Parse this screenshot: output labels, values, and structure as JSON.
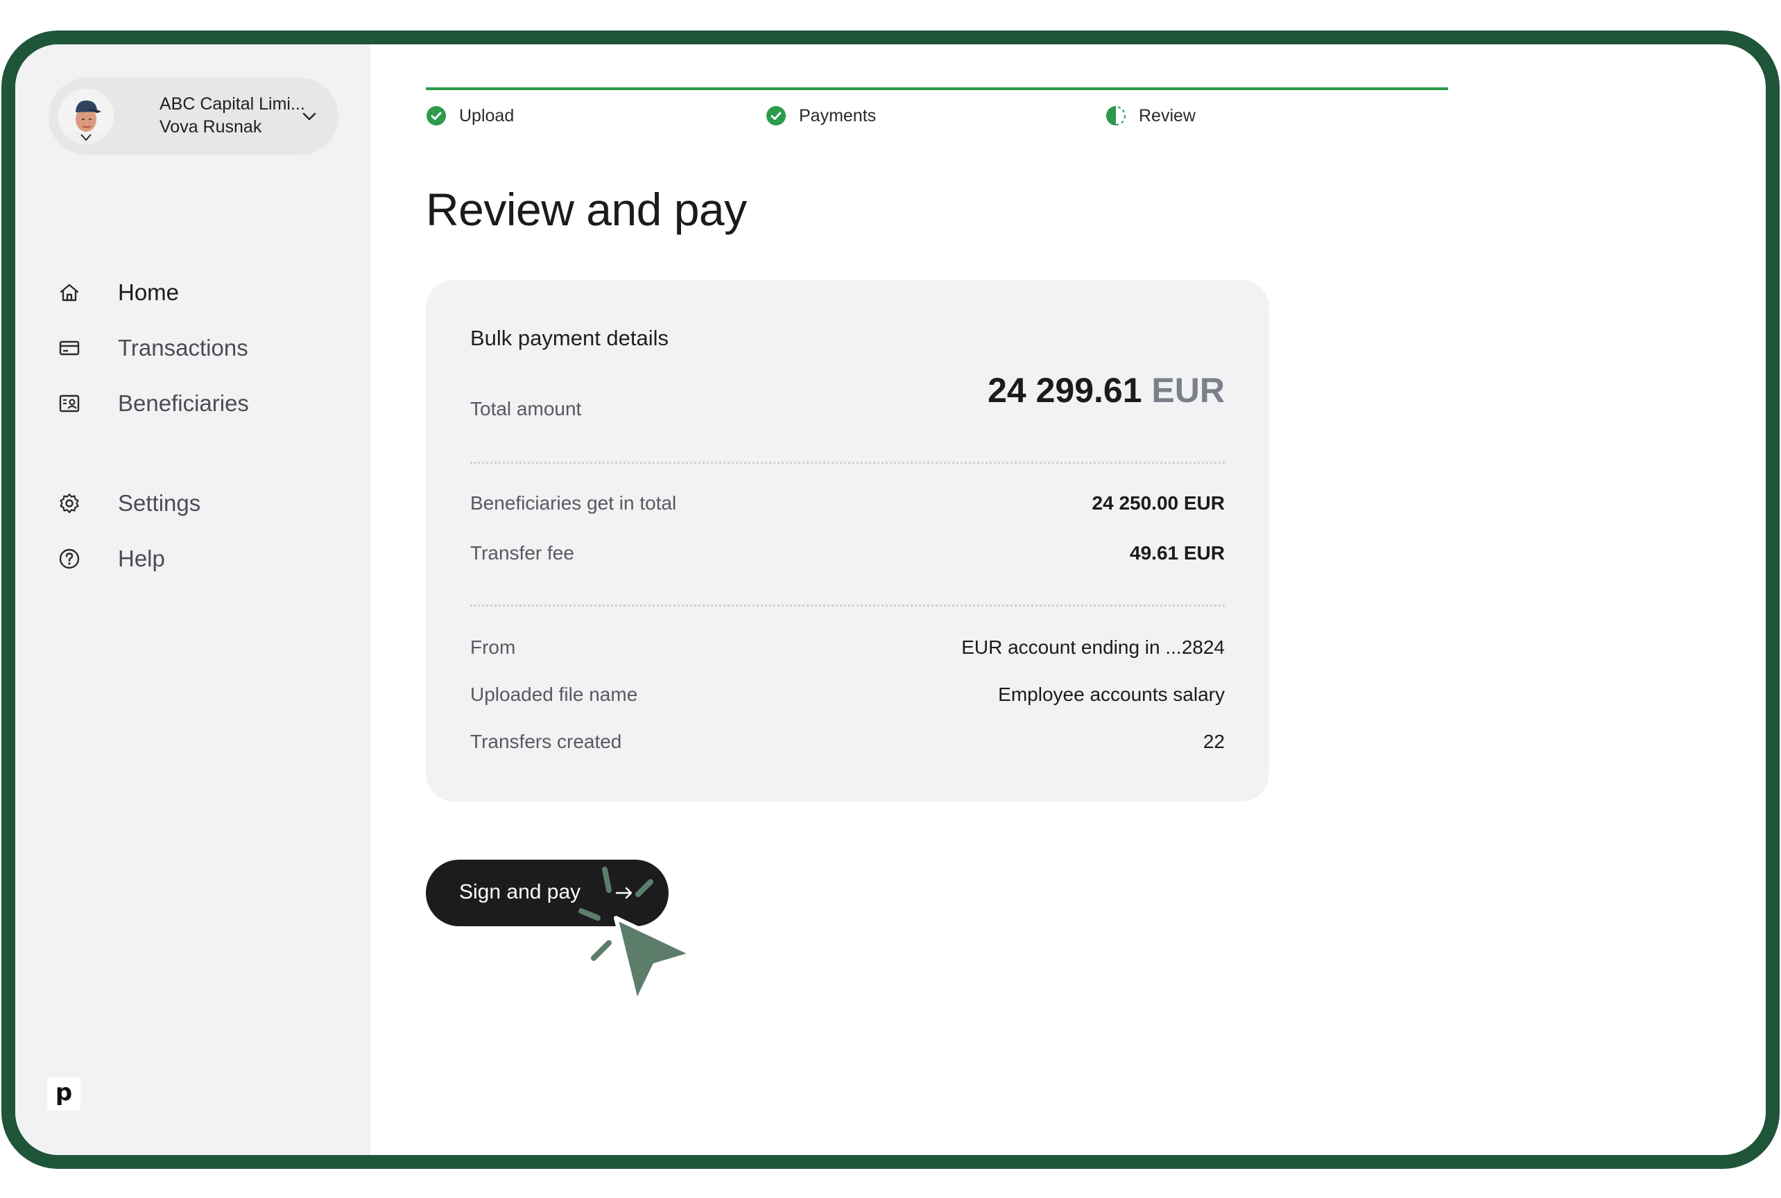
{
  "sidebar": {
    "account": {
      "company": "ABC Capital Limi...",
      "user": "Vova Rusnak",
      "avatar_icon": "user-avatar",
      "dropdown_icon": "chevron-down-icon"
    },
    "nav": {
      "home": {
        "label": "Home",
        "icon": "home-icon"
      },
      "transactions": {
        "label": "Transactions",
        "icon": "card-icon"
      },
      "beneficiaries": {
        "label": "Beneficiaries",
        "icon": "contact-card-icon"
      },
      "settings": {
        "label": "Settings",
        "icon": "gear-icon"
      },
      "help": {
        "label": "Help",
        "icon": "question-circle-icon"
      }
    },
    "logo_text": "p"
  },
  "stepper": {
    "progress_color": "#2e9a4c",
    "steps": [
      {
        "label": "Upload",
        "status": "complete",
        "icon": "check-circle-icon"
      },
      {
        "label": "Payments",
        "status": "complete",
        "icon": "check-circle-icon"
      },
      {
        "label": "Review",
        "status": "in-progress",
        "icon": "half-circle-icon"
      }
    ]
  },
  "main": {
    "title": "Review and pay",
    "card": {
      "title": "Bulk payment details",
      "total": {
        "label": "Total amount",
        "amount": "24 299.61",
        "currency": "EUR"
      },
      "breakdown": {
        "beneficiaries": {
          "label": "Beneficiaries get in total",
          "value": "24 250.00 EUR"
        },
        "fee": {
          "label": "Transfer fee",
          "value": "49.61 EUR"
        }
      },
      "details": {
        "from": {
          "label": "From",
          "value": "EUR account ending in ...2824"
        },
        "file": {
          "label": "Uploaded file name",
          "value": "Employee accounts salary"
        },
        "transfers": {
          "label": "Transfers created",
          "value": "22"
        }
      }
    },
    "action": {
      "label": "Sign and pay",
      "icon": "arrow-right-icon"
    }
  },
  "colors": {
    "frame": "#1f5539",
    "sidebar_bg": "#f2f2f4",
    "accent_green": "#2e9a4c",
    "button_bg": "#1c1c1e",
    "cursor": "#5d7d6b"
  }
}
